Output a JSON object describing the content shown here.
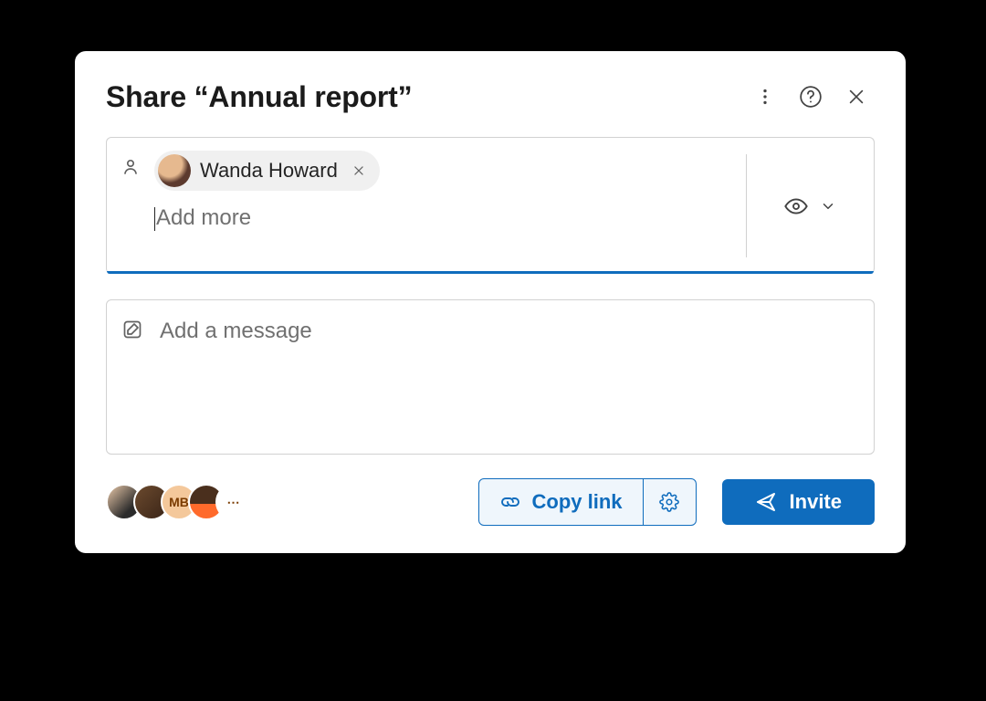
{
  "dialog": {
    "title": "Share “Annual report”"
  },
  "people": {
    "chips": [
      {
        "name": "Wanda Howard"
      }
    ],
    "add_more_placeholder": "Add more",
    "permission_label": "Can view"
  },
  "message": {
    "placeholder": "Add a message"
  },
  "shared_with": {
    "overflow_label": "⋯",
    "initials": [
      "",
      "",
      "MB",
      ""
    ]
  },
  "actions": {
    "copy_link": "Copy link",
    "invite": "Invite"
  }
}
